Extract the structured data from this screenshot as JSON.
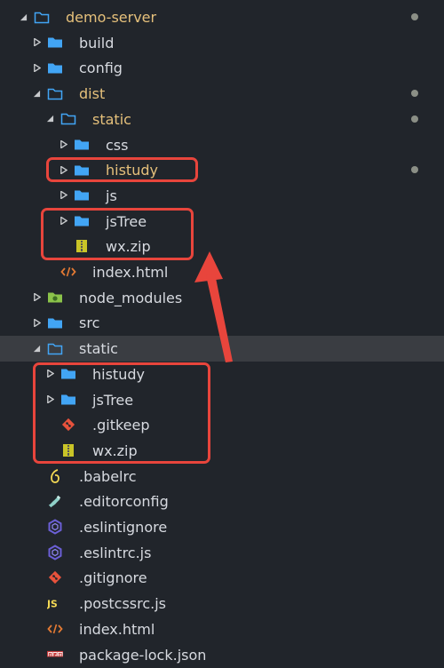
{
  "explorer": {
    "items": [
      {
        "label": "demo-server",
        "depth": 0,
        "kind": "folder-open",
        "expanded": true,
        "modified": true,
        "dot": true
      },
      {
        "label": "build",
        "depth": 1,
        "kind": "folder",
        "expanded": false
      },
      {
        "label": "config",
        "depth": 1,
        "kind": "folder",
        "expanded": false
      },
      {
        "label": "dist",
        "depth": 1,
        "kind": "folder-open",
        "expanded": true,
        "modified": true,
        "dot": true
      },
      {
        "label": "static",
        "depth": 2,
        "kind": "folder-open",
        "expanded": true,
        "modified": true,
        "dot": true
      },
      {
        "label": "css",
        "depth": 3,
        "kind": "folder",
        "expanded": false
      },
      {
        "label": "histudy",
        "depth": 3,
        "kind": "folder",
        "expanded": false,
        "modified": true,
        "dot": true
      },
      {
        "label": "js",
        "depth": 3,
        "kind": "folder",
        "expanded": false
      },
      {
        "label": "jsTree",
        "depth": 3,
        "kind": "folder",
        "expanded": false
      },
      {
        "label": "wx.zip",
        "depth": 3,
        "kind": "zip"
      },
      {
        "label": "index.html",
        "depth": 2,
        "kind": "html"
      },
      {
        "label": "node_modules",
        "depth": 1,
        "kind": "node",
        "expanded": false
      },
      {
        "label": "src",
        "depth": 1,
        "kind": "folder",
        "expanded": false
      },
      {
        "label": "static",
        "depth": 1,
        "kind": "folder-open",
        "expanded": true,
        "selected": true
      },
      {
        "label": "histudy",
        "depth": 2,
        "kind": "folder",
        "expanded": false
      },
      {
        "label": "jsTree",
        "depth": 2,
        "kind": "folder",
        "expanded": false
      },
      {
        "label": ".gitkeep",
        "depth": 2,
        "kind": "git"
      },
      {
        "label": "wx.zip",
        "depth": 2,
        "kind": "zip"
      },
      {
        "label": ".babelrc",
        "depth": 1,
        "kind": "babel"
      },
      {
        "label": ".editorconfig",
        "depth": 1,
        "kind": "editorconfig"
      },
      {
        "label": ".eslintignore",
        "depth": 1,
        "kind": "eslint"
      },
      {
        "label": ".eslintrc.js",
        "depth": 1,
        "kind": "eslint"
      },
      {
        "label": ".gitignore",
        "depth": 1,
        "kind": "git"
      },
      {
        "label": ".postcssrc.js",
        "depth": 1,
        "kind": "js"
      },
      {
        "label": "index.html",
        "depth": 1,
        "kind": "html"
      },
      {
        "label": "package-lock.json",
        "depth": 1,
        "kind": "npm"
      }
    ]
  },
  "colors": {
    "background": "#21252b",
    "text": "#d7dae0",
    "modified_text": "#e5c07b",
    "folder": "#42a5f5",
    "annotation": "#e8453c"
  }
}
